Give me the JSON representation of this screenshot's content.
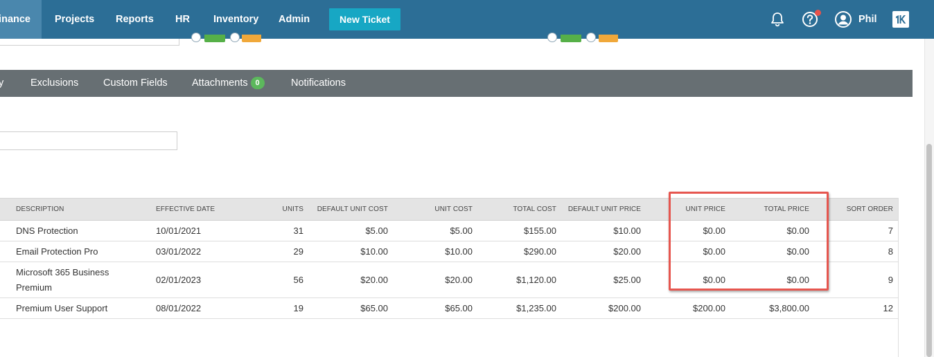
{
  "nav": {
    "items": [
      {
        "label": "Finance",
        "active": true
      },
      {
        "label": "Projects"
      },
      {
        "label": "Reports"
      },
      {
        "label": "HR"
      },
      {
        "label": "Inventory"
      },
      {
        "label": "Admin"
      }
    ],
    "new_ticket_label": "New Ticket",
    "user_name": "Phil",
    "icons": [
      "bell-icon",
      "help-circle-icon",
      "user-avatar-icon",
      "brand-logo-icon"
    ],
    "notification_dot_color": "#e8524b"
  },
  "tabs": [
    {
      "label": "y"
    },
    {
      "label": "Exclusions"
    },
    {
      "label": "Custom Fields"
    },
    {
      "label": "Attachments",
      "badge": "0"
    },
    {
      "label": "Notifications"
    }
  ],
  "colors": {
    "nav_bg": "#2c6e96",
    "nav_active_bg": "#4a87ad",
    "new_ticket_bg": "#17a7c4",
    "tabbar_bg": "#676f73",
    "badge_green": "#5cb85c",
    "highlight_red": "#e6564f"
  },
  "table": {
    "columns": [
      "DESCRIPTION",
      "EFFECTIVE DATE",
      "UNITS",
      "DEFAULT UNIT COST",
      "UNIT COST",
      "TOTAL COST",
      "DEFAULT UNIT PRICE",
      "UNIT PRICE",
      "TOTAL PRICE",
      "SORT ORDER"
    ],
    "rows": [
      [
        "DNS Protection",
        "10/01/2021",
        "31",
        "$5.00",
        "$5.00",
        "$155.00",
        "$10.00",
        "$0.00",
        "$0.00",
        "7"
      ],
      [
        "Email Protection Pro",
        "03/01/2022",
        "29",
        "$10.00",
        "$10.00",
        "$290.00",
        "$20.00",
        "$0.00",
        "$0.00",
        "8"
      ],
      [
        "Microsoft 365 Business Premium",
        "02/01/2023",
        "56",
        "$20.00",
        "$20.00",
        "$1,120.00",
        "$25.00",
        "$0.00",
        "$0.00",
        "9"
      ],
      [
        "Premium User Support",
        "08/01/2022",
        "19",
        "$65.00",
        "$65.00",
        "$1,235.00",
        "$200.00",
        "$200.00",
        "$3,800.00",
        "12"
      ]
    ]
  }
}
